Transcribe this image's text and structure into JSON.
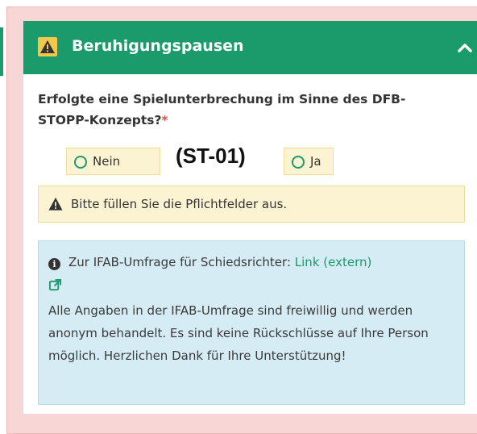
{
  "panel": {
    "title": "Beruhigungspausen"
  },
  "question": {
    "text": "Erfolgte eine Spielunterbrechung im Sinne des DFB-STOPP-Konzepts?",
    "required_marker": "*",
    "options": [
      "Nein",
      "Ja"
    ],
    "code_label": "(ST-01)"
  },
  "warning": {
    "text": "Bitte füllen Sie die Pflichtfelder aus."
  },
  "info": {
    "lead_text": "Zur IFAB-Umfrage für Schiedsrichter:",
    "link_text": "Link (extern)",
    "body": "Alle Angaben in der IFAB-Umfrage sind freiwillig und werden anonym behandelt. Es sind keine Rückschlüsse auf Ihre Person möglich. Herzlichen Dank für Ihre Unterstützung!"
  },
  "icons": {
    "header": "warning-icon",
    "collapse": "chevron-up-icon",
    "alert": "warning-icon",
    "info": "info-icon",
    "external": "external-link-icon"
  },
  "colors": {
    "header_green": "#1b9a6c",
    "warning_bg": "#fcf3d2",
    "info_bg": "#d5ecf5",
    "required_red": "#d9534f",
    "outer_pink": "#f9d6d6"
  }
}
